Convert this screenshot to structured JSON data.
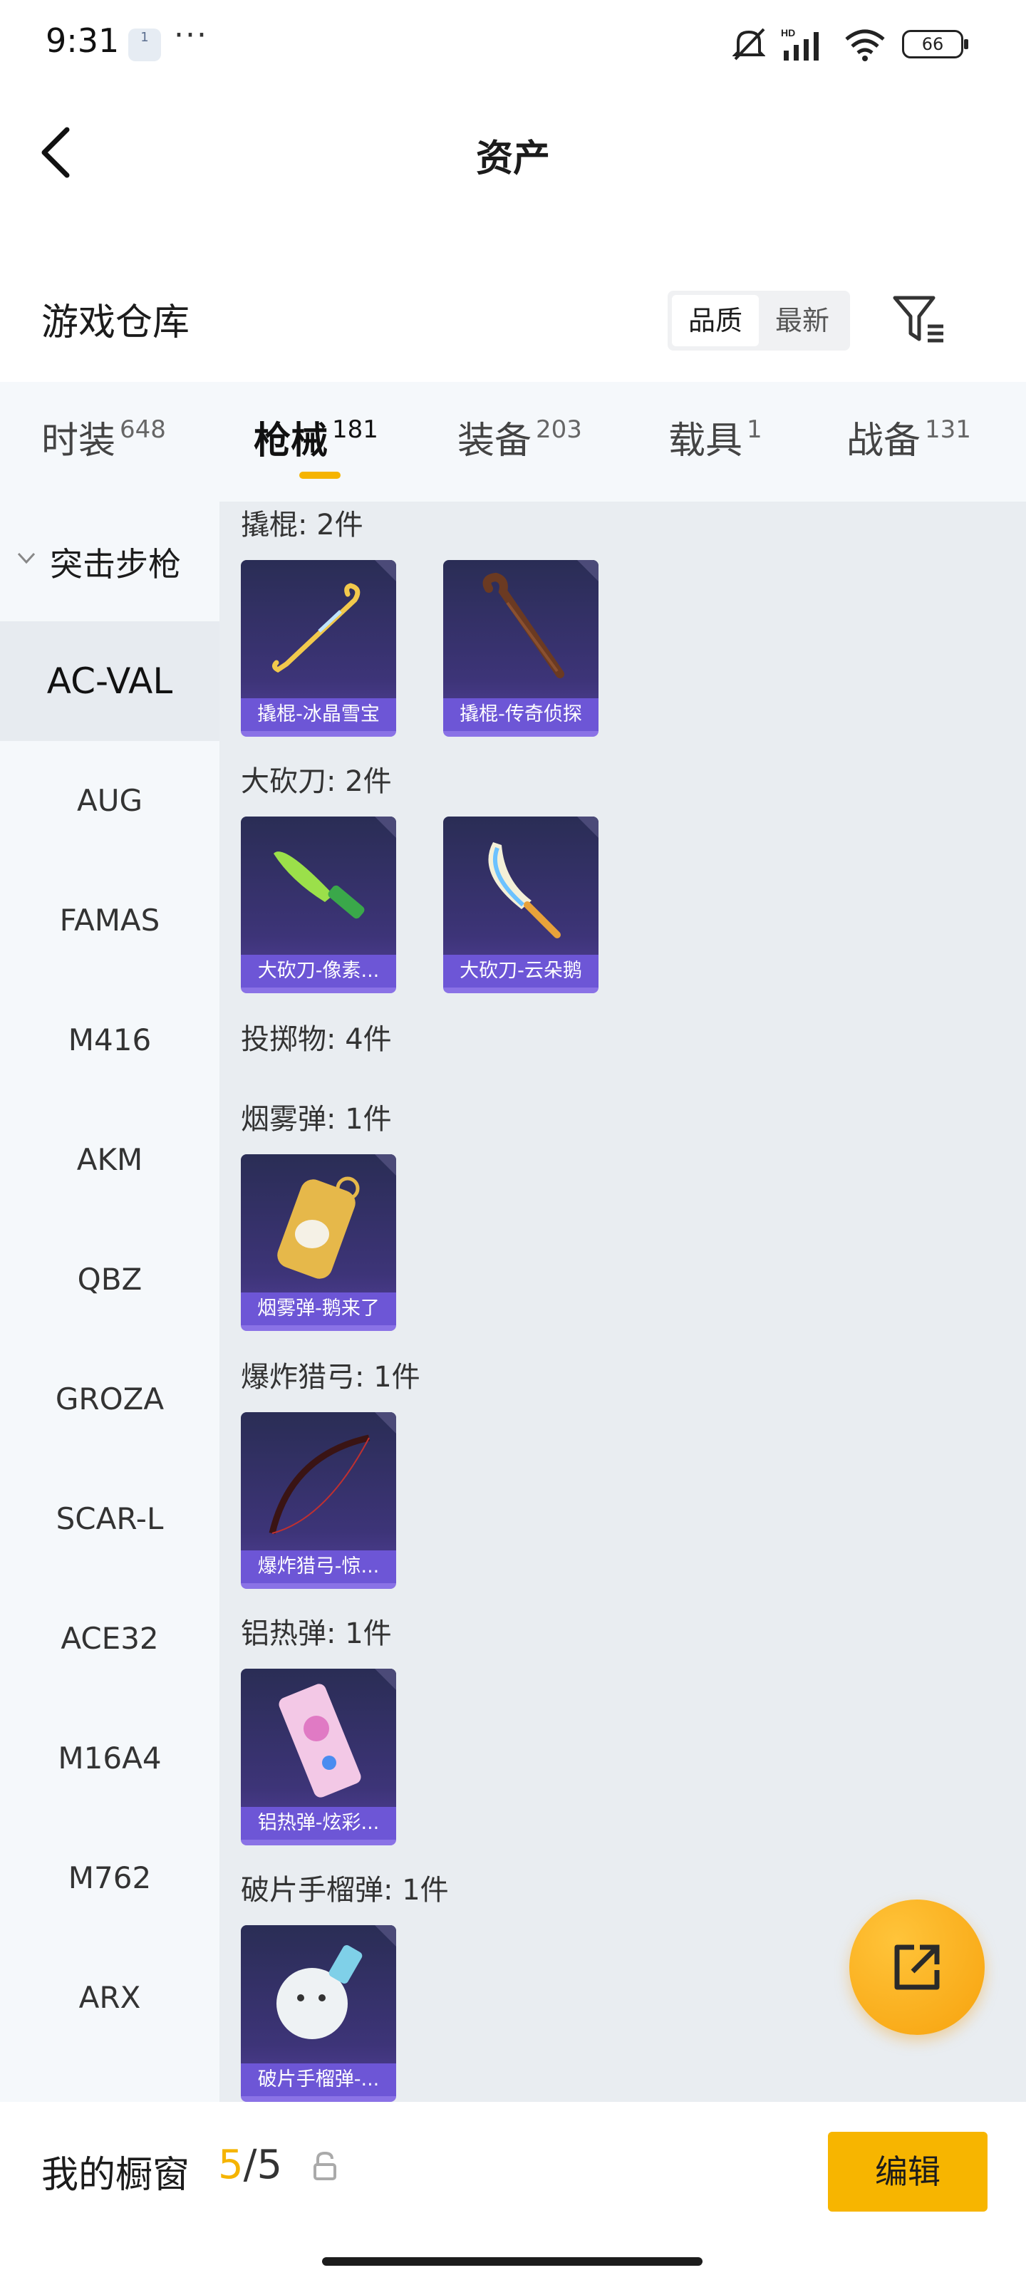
{
  "status_bar": {
    "time": "9:31",
    "notification_badge": "1",
    "battery": "66",
    "network": "HD"
  },
  "header": {
    "title": "资产"
  },
  "warehouse": {
    "title": "游戏仓库",
    "sort_options": [
      {
        "label": "品质",
        "active": true
      },
      {
        "label": "最新",
        "active": false
      }
    ]
  },
  "tabs": [
    {
      "label": "时装",
      "count": "648",
      "active": false
    },
    {
      "label": "枪械",
      "count": "181",
      "active": true
    },
    {
      "label": "装备",
      "count": "203",
      "active": false
    },
    {
      "label": "载具",
      "count": "1",
      "active": false
    },
    {
      "label": "战备",
      "count": "131",
      "active": false
    }
  ],
  "sidebar": {
    "group_label": "突击步枪",
    "items": [
      {
        "label": "AC-VAL",
        "active": true
      },
      {
        "label": "AUG",
        "active": false
      },
      {
        "label": "FAMAS",
        "active": false
      },
      {
        "label": "M416",
        "active": false
      },
      {
        "label": "AKM",
        "active": false
      },
      {
        "label": "QBZ",
        "active": false
      },
      {
        "label": "GROZA",
        "active": false
      },
      {
        "label": "SCAR-L",
        "active": false
      },
      {
        "label": "ACE32",
        "active": false
      },
      {
        "label": "M16A4",
        "active": false
      },
      {
        "label": "M762",
        "active": false
      },
      {
        "label": "ARX",
        "active": false
      }
    ]
  },
  "content": {
    "groups": [
      {
        "title": "撬棍: 2件",
        "items": [
          {
            "name": "撬棍-冰晶雪宝",
            "icon": "crowbar-icon"
          },
          {
            "name": "撬棍-传奇侦探",
            "icon": "cane-icon"
          }
        ]
      },
      {
        "title": "大砍刀: 2件",
        "items": [
          {
            "name": "大砍刀-像素...",
            "icon": "machete-icon"
          },
          {
            "name": "大砍刀-云朵鹅",
            "icon": "machete-icon"
          }
        ]
      },
      {
        "title": "投掷物: 4件",
        "items": []
      },
      {
        "title": "烟雾弹: 1件",
        "items": [
          {
            "name": "烟雾弹-鹅来了",
            "icon": "smoke-grenade-icon"
          }
        ]
      },
      {
        "title": "爆炸猎弓: 1件",
        "items": [
          {
            "name": "爆炸猎弓-惊...",
            "icon": "bow-icon"
          }
        ]
      },
      {
        "title": "铝热弹: 1件",
        "items": [
          {
            "name": "铝热弹-炫彩...",
            "icon": "thermite-icon"
          }
        ]
      },
      {
        "title": "破片手榴弹: 1件",
        "items": [
          {
            "name": "破片手榴弹-...",
            "icon": "frag-grenade-icon"
          }
        ]
      }
    ]
  },
  "bottom_bar": {
    "showcase_label": "我的橱窗",
    "current": "5",
    "separator": "/",
    "total": "5",
    "edit_label": "编辑"
  },
  "colors": {
    "accent": "#f7b500",
    "card_caption": "#6d56d6",
    "card_border": "#8a72e6",
    "content_bg": "#e9edf1",
    "sidebar_bg": "#f5f8fb"
  }
}
